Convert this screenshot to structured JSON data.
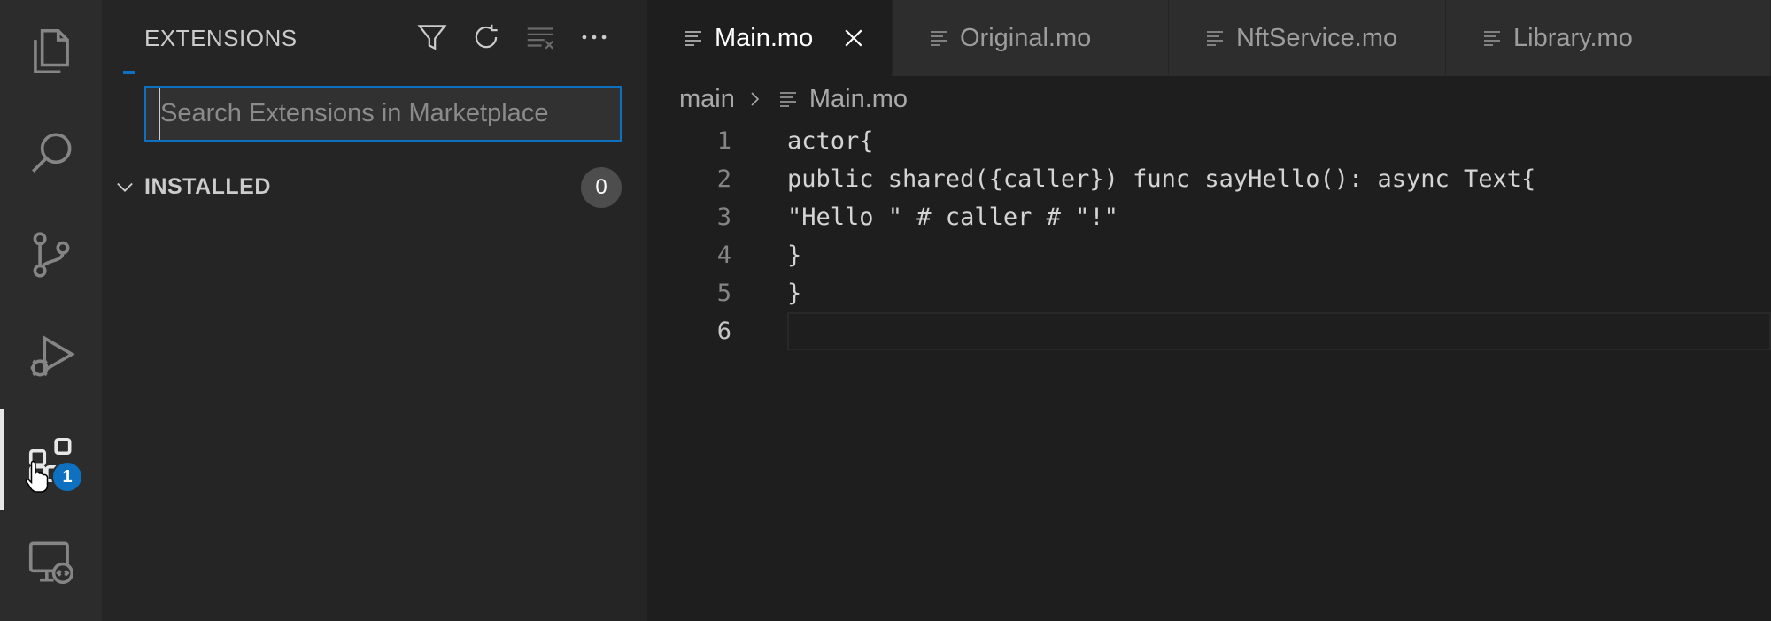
{
  "activity_bar": {
    "items": [
      {
        "icon": "explorer-icon"
      },
      {
        "icon": "search-icon"
      },
      {
        "icon": "source-control-icon"
      },
      {
        "icon": "run-debug-icon"
      },
      {
        "icon": "extensions-icon",
        "active": true,
        "badge": "1"
      },
      {
        "icon": "remote-explorer-icon"
      }
    ],
    "badge_count": "1"
  },
  "sidebar": {
    "title": "EXTENSIONS",
    "actions": [
      "filter-icon",
      "refresh-icon",
      "clear-icon",
      "more-icon"
    ],
    "search": {
      "placeholder": "Search Extensions in Marketplace",
      "value": ""
    },
    "installed": {
      "label": "INSTALLED",
      "count": "0"
    }
  },
  "editor": {
    "tabs": [
      {
        "label": "Main.mo",
        "active": true
      },
      {
        "label": "Original.mo",
        "active": false
      },
      {
        "label": "NftService.mo",
        "active": false
      },
      {
        "label": "Library.mo",
        "active": false
      }
    ],
    "breadcrumb": {
      "folder": "main",
      "file": "Main.mo"
    },
    "lines": [
      {
        "num": "1",
        "text": "actor{"
      },
      {
        "num": "2",
        "text": "public shared({caller}) func sayHello(): async Text{"
      },
      {
        "num": "3",
        "text": "\"Hello \" # caller # \"!\""
      },
      {
        "num": "4",
        "text": "}"
      },
      {
        "num": "5",
        "text": "}"
      },
      {
        "num": "6",
        "text": ""
      }
    ]
  },
  "colors": {
    "accent": "#0e70c0",
    "activity_bar_bg": "#2c2c2c",
    "sidebar_bg": "#252526",
    "editor_bg": "#1e1e1e"
  }
}
